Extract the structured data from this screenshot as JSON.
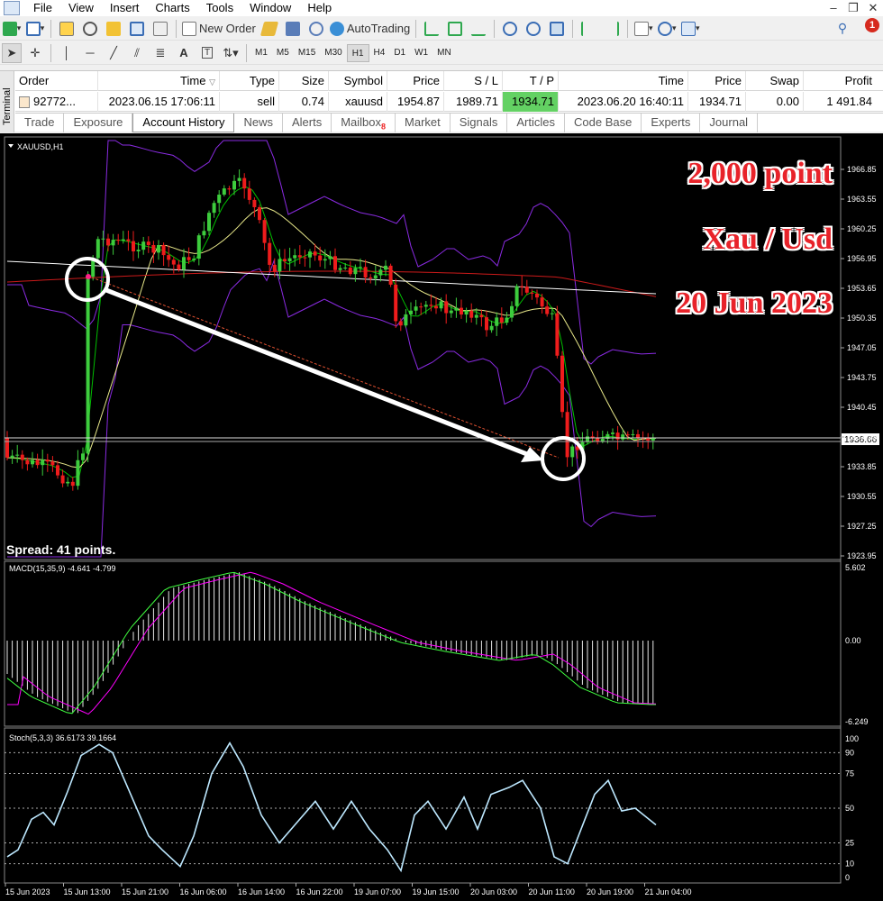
{
  "menu": [
    "File",
    "View",
    "Insert",
    "Charts",
    "Tools",
    "Window",
    "Help"
  ],
  "window_controls": [
    "–",
    "❐",
    "✕"
  ],
  "toolbar": {
    "new_order_label": "New Order",
    "autotrading_label": "AutoTrading",
    "notification_count": "1",
    "timeframes": [
      "M1",
      "M5",
      "M15",
      "M30",
      "H1",
      "H4",
      "D1",
      "W1",
      "MN"
    ],
    "active_timeframe": "H1"
  },
  "terminal": {
    "side_label": "Terminal",
    "columns": [
      "Order",
      "Time",
      "Type",
      "Size",
      "Symbol",
      "Price",
      "S / L",
      "T / P",
      "Time",
      "Price",
      "Swap",
      "Profit"
    ],
    "row": {
      "order": "92772...",
      "open_time": "2023.06.15 17:06:11",
      "type": "sell",
      "size": "0.74",
      "symbol": "xauusd",
      "price": "1954.87",
      "sl": "1989.71",
      "tp": "1934.71",
      "close_time": "2023.06.20 16:40:11",
      "close_price": "1934.71",
      "swap": "0.00",
      "profit": "1 491.84"
    },
    "tabs": [
      "Trade",
      "Exposure",
      "Account History",
      "News",
      "Alerts",
      "Mailbox",
      "Market",
      "Signals",
      "Articles",
      "Code Base",
      "Experts",
      "Journal"
    ],
    "mailbox_count": "8",
    "active_tab": "Account History"
  },
  "chart": {
    "symbol_label": "XAUUSD,H1",
    "spread_text": "Spread: 41 points.",
    "overlay_lines": [
      "2,000 point",
      "Xau / Usd",
      "20 Jun 2023"
    ],
    "price_ticks": [
      "1966.85",
      "1963.55",
      "1960.25",
      "1956.95",
      "1953.65",
      "1950.35",
      "1947.05",
      "1943.75",
      "1940.45",
      "1937.15",
      "1933.85",
      "1930.55",
      "1927.25",
      "1923.95"
    ],
    "current_price": "1936.66",
    "macd_label": "MACD(15,35,9) -4.641 -4.799",
    "macd_ticks": [
      "5.602",
      "0.00",
      "-6.249"
    ],
    "stoch_label": "Stoch(5,3,3) 36.6173 39.1664",
    "stoch_ticks": [
      "100",
      "90",
      "75",
      "50",
      "25",
      "10",
      "0"
    ],
    "time_ticks": [
      "15 Jun 2023",
      "15 Jun 13:00",
      "15 Jun 21:00",
      "16 Jun 06:00",
      "16 Jun 14:00",
      "16 Jun 22:00",
      "19 Jun 07:00",
      "19 Jun 15:00",
      "20 Jun 03:00",
      "20 Jun 11:00",
      "20 Jun 19:00",
      "21 Jun 04:00"
    ],
    "colors": {
      "bull": "#3dcc3d",
      "bear": "#ee1c1c",
      "bollinger": "#8a2be2",
      "ma_fast": "#00c000",
      "ma_mid": "#e8e88a",
      "ma_red": "#cc1a1a",
      "ma_white": "#ffffff",
      "macd_signal": "#ff00ff",
      "macd_main": "#40ff40",
      "stoch": "#bde8ff"
    }
  }
}
